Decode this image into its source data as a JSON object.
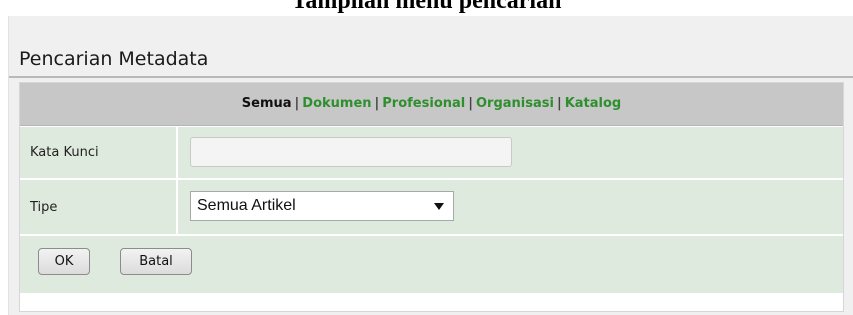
{
  "caption": "Tampilan menu pencarian",
  "panel": {
    "title": "Pencarian Metadata"
  },
  "nav": {
    "active": "Semua",
    "separator": "|",
    "links": [
      "Dokumen",
      "Profesional",
      "Organisasi",
      "Katalog"
    ],
    "colors": {
      "link": "#2f8f2f",
      "bar": "#c7c7c7",
      "row": "#dfeade"
    }
  },
  "form": {
    "keyword": {
      "label": "Kata Kunci",
      "value": ""
    },
    "type": {
      "label": "Tipe",
      "selected": "Semua Artikel"
    },
    "buttons": {
      "ok": "OK",
      "cancel": "Batal"
    }
  }
}
